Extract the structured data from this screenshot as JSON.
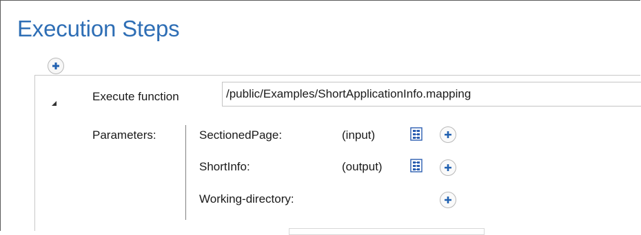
{
  "header": {
    "title": "Execution Steps"
  },
  "step": {
    "execute_label": "Execute function",
    "function_path": "/public/Examples/ShortApplicationInfo.mapping",
    "parameters_label": "Parameters:",
    "parameters": [
      {
        "name": "SectionedPage:",
        "direction": "(input)",
        "has_mapping_icon": true
      },
      {
        "name": "ShortInfo:",
        "direction": "(output)",
        "has_mapping_icon": true
      },
      {
        "name": "Working-directory:",
        "direction": "",
        "has_mapping_icon": false
      }
    ]
  },
  "icons": {
    "add": "plus-icon",
    "mapping": "mapping-file-icon",
    "collapse": "collapse-triangle-icon"
  },
  "colors": {
    "title": "#2e6eb5",
    "plus": "#2060b0",
    "mapping_icon": "#2a5db0"
  }
}
